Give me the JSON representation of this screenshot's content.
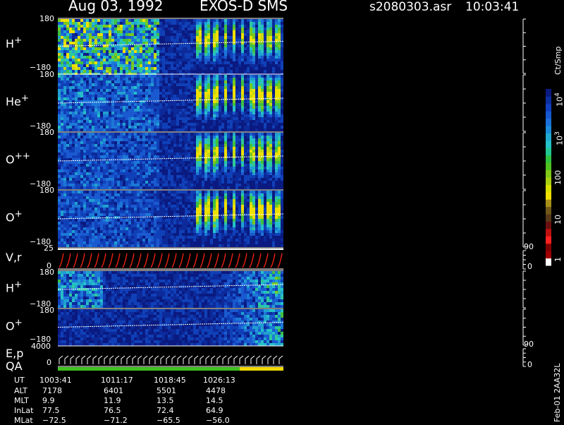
{
  "header": {
    "date": "Aug 03, 1992",
    "instrument": "EXOS-D SMS",
    "file": "s2080303.asr",
    "time": "10:03:41"
  },
  "colorbar": {
    "unit": "Ct/Smp",
    "ticks": [
      "1",
      "10",
      "100",
      "10",
      "10"
    ],
    "tick_exponents": [
      "",
      "",
      "",
      "3",
      "4"
    ],
    "colors": [
      "#0a1a80",
      "#0b2fa0",
      "#1040c0",
      "#1558d0",
      "#1a70d8",
      "#1c8ad8",
      "#20a8d0",
      "#24c0c8",
      "#20c890",
      "#30c040",
      "#50c020",
      "#80c818",
      "#a8d010",
      "#d8e000",
      "#f0e000",
      "#a89018",
      "#705818",
      "#583818",
      "#6a1010",
      "#c01010",
      "#ff2020",
      "#800000",
      "#a00000",
      "#ffffff"
    ]
  },
  "side_ticks": {
    "vr_right": [
      "90",
      "0"
    ],
    "ep_right": [
      "90",
      "0"
    ]
  },
  "chart_data": {
    "type": "heatmap",
    "x_axis": "UT",
    "panels": [
      {
        "name": "H",
        "sup": "+",
        "ymax": "180",
        "ymin": "−180"
      },
      {
        "name": "He",
        "sup": "+",
        "ymax": "180",
        "ymin": "−180"
      },
      {
        "name": "O",
        "sup": "++",
        "ymax": "180",
        "ymin": "−180"
      },
      {
        "name": "O",
        "sup": "+",
        "ymax": "180",
        "ymin": "−180"
      },
      {
        "name": "V,r",
        "sup": "",
        "ymax": "25",
        "ymin": "0"
      },
      {
        "name": "H",
        "sup": "+",
        "ymax": "180",
        "ymin": "−180"
      },
      {
        "name": "O",
        "sup": "+",
        "ymax": "180",
        "ymin": "−180"
      },
      {
        "name": "E,p",
        "sup": "",
        "ymax": "4000",
        "ymin": "0"
      }
    ],
    "qa_label": "QA",
    "ephemeris": {
      "labels": [
        "UT",
        "ALT",
        "MLT",
        "InLat",
        "MLat"
      ],
      "columns": [
        [
          "1003:41",
          "7178",
          "9.9",
          "77.5",
          "−72.5"
        ],
        [
          "1011:17",
          "6401",
          "11.9",
          "76.5",
          "−71.2"
        ],
        [
          "1018:45",
          "5501",
          "13.5",
          "72.4",
          "−65.5"
        ],
        [
          "1026:13",
          "4478",
          "14.5",
          "64.9",
          "−56.0"
        ]
      ]
    }
  },
  "footer": {
    "version": "Feb-01 2AA32L"
  }
}
